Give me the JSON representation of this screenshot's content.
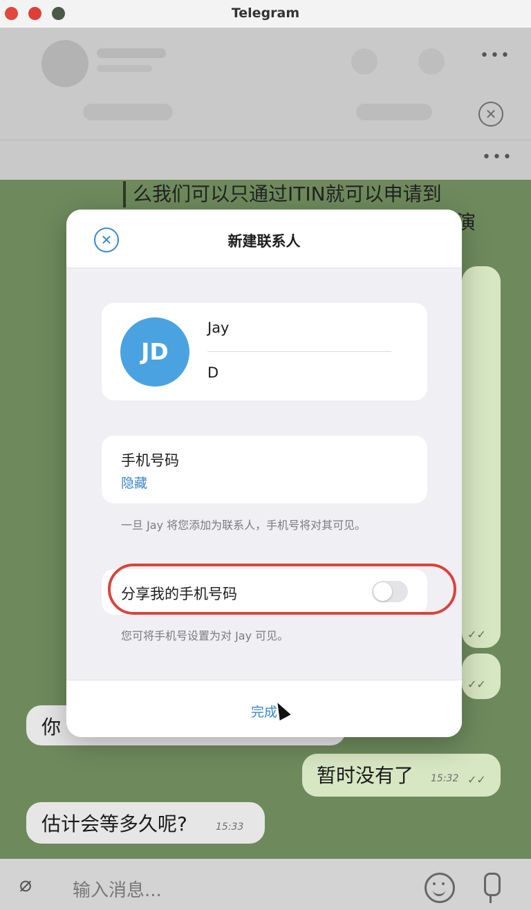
{
  "window": {
    "title": "Telegram"
  },
  "chat": {
    "quoted_line1": "么我们可以只通过ITIN就可以申请到",
    "quoted_cut": "演",
    "msg_in_partial": "你",
    "msg_out": {
      "text": "暂时没有了",
      "time": "15:32",
      "ticks": "✓✓"
    },
    "msg_in": {
      "text": "估计会等多久呢?",
      "time": "15:33"
    },
    "hidden_ticks_1": "✓✓",
    "hidden_ticks_2": "✓✓",
    "input_placeholder": "输入消息..."
  },
  "dialog": {
    "title": "新建联系人",
    "avatar_initials": "JD",
    "avatar_color": "#4aa3e0",
    "first_name": "Jay",
    "last_name": "D",
    "phone_label": "手机号码",
    "phone_value": "隐藏",
    "phone_note": "一旦 Jay 将您添加为联系人，手机号将对其可见。",
    "share_label": "分享我的手机号码",
    "share_enabled": false,
    "share_note": "您可将手机号设置为对 Jay 可见。",
    "done_label": "完成",
    "accent_color": "#3a86c8"
  },
  "annotation": {
    "highlight_color": "#d9433a"
  }
}
